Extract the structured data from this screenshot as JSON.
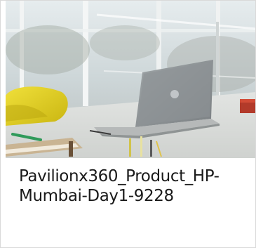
{
  "card": {
    "image_alt": "HP Pavilion x360 laptop on an office table",
    "title_line1": "Pavilionx360_Product_HP-",
    "title_line2": "Mumbai-Day1-9228"
  }
}
